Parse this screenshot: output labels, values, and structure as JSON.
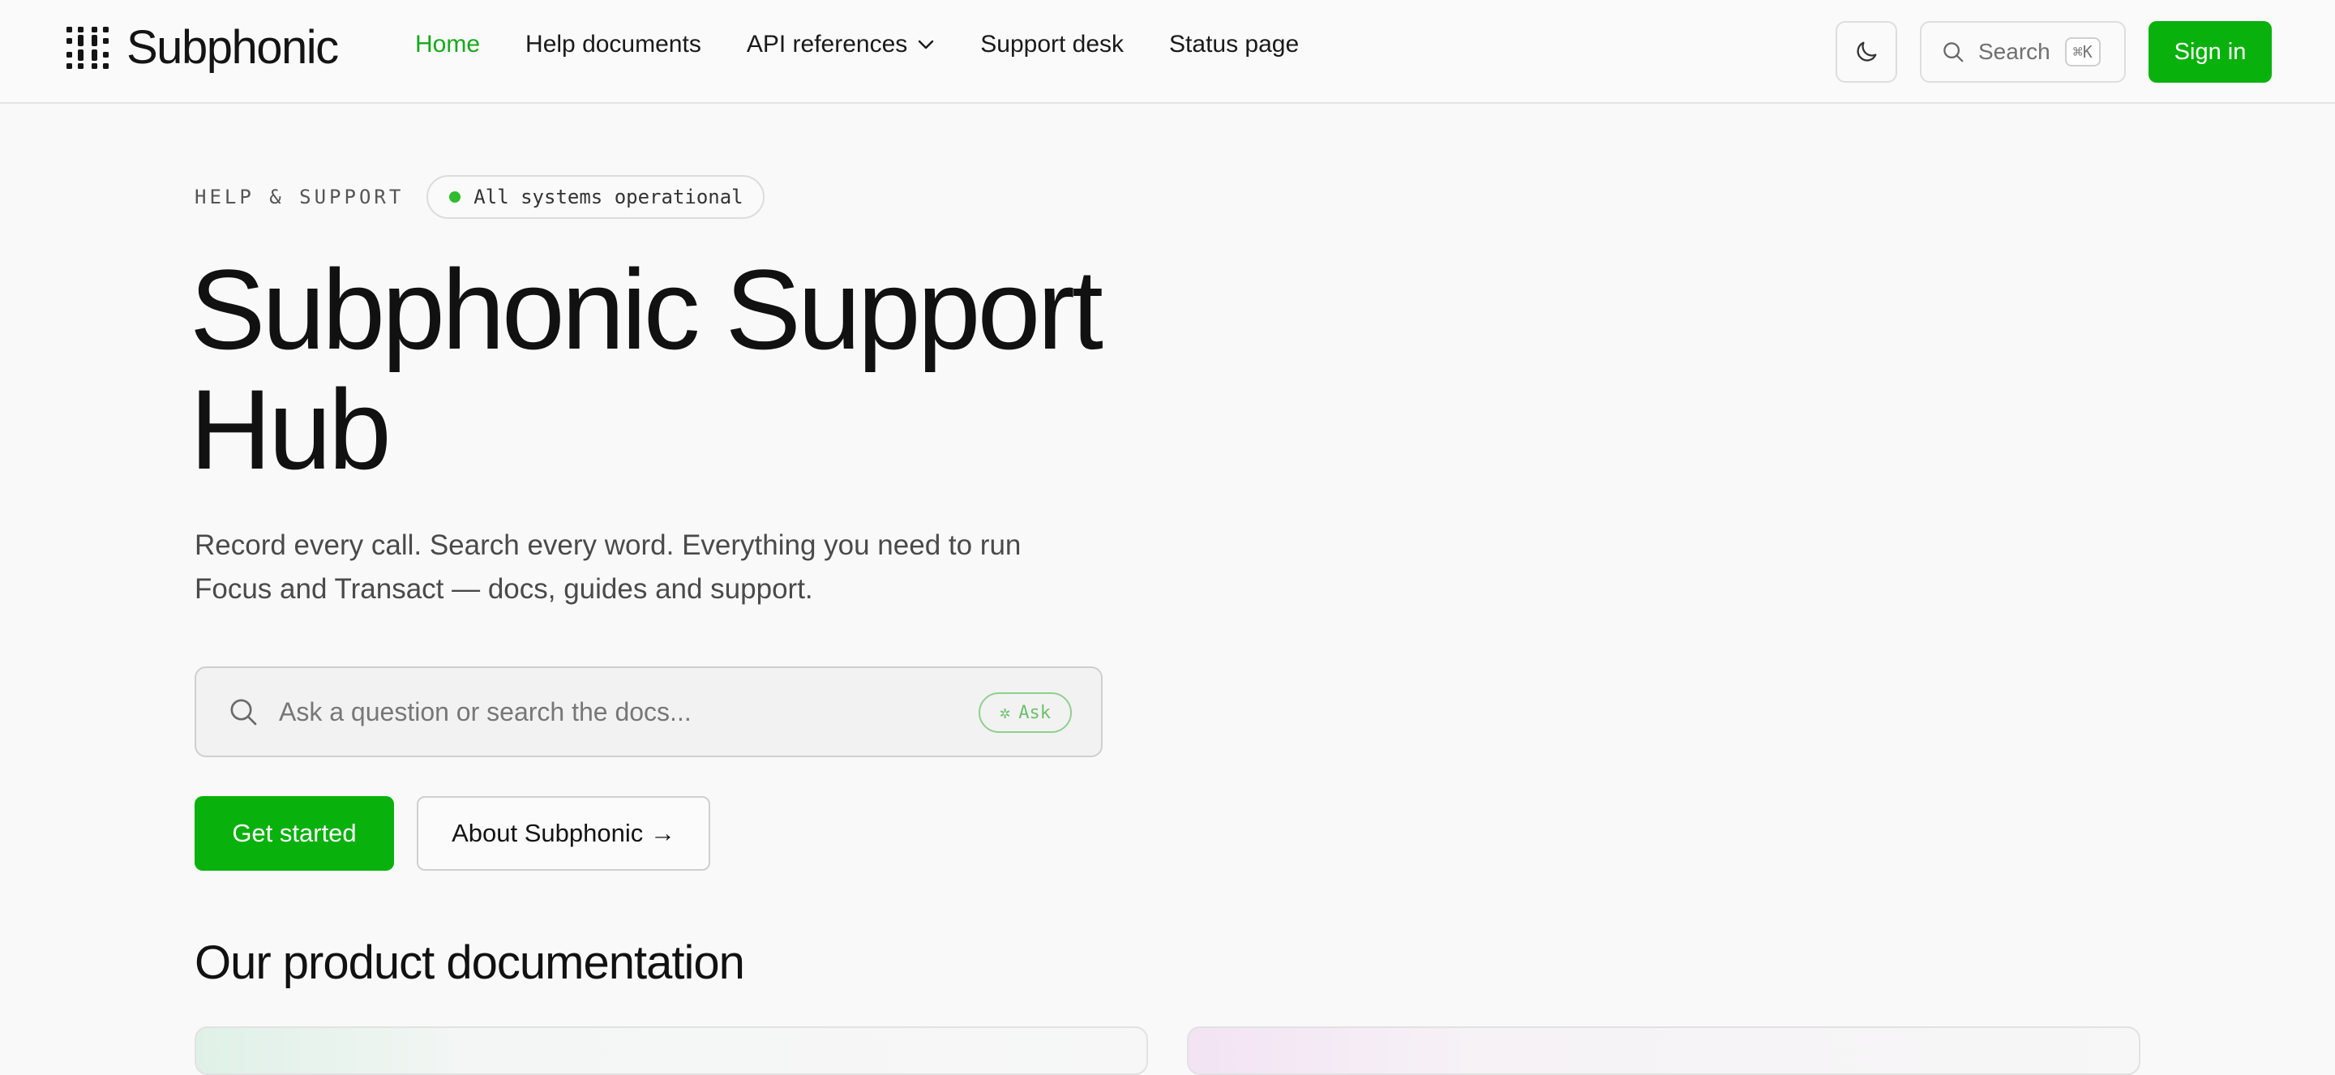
{
  "header": {
    "brand": "Subphonic",
    "nav": [
      {
        "label": "Home",
        "active": true
      },
      {
        "label": "Help documents"
      },
      {
        "label": "API references",
        "has_dropdown": true
      },
      {
        "label": "Support desk"
      },
      {
        "label": "Status page"
      }
    ],
    "search_label": "Search",
    "search_shortcut": "⌘K",
    "signin_label": "Sign in"
  },
  "hero": {
    "eyebrow": "HELP & SUPPORT",
    "status": "All systems operational",
    "title": "Subphonic Support Hub",
    "subtitle": "Record every call. Search every word. Everything you need to run Focus and Transact — docs, guides and support.",
    "ask_placeholder": "Ask a question or search the docs...",
    "ask_chip": "Ask",
    "primary_cta": "Get started",
    "secondary_cta": "About Subphonic →"
  },
  "docs_section": {
    "title": "Our product documentation"
  },
  "colors": {
    "accent": "#09b10c",
    "active_nav": "#17a81c",
    "status_ok": "#2fbd2f"
  },
  "icons": {
    "logo": "dotted-grid-logo-icon",
    "theme": "moon-icon",
    "search": "search-icon",
    "dropdown": "chevron-down-icon",
    "ask": "sparkle-icon"
  }
}
